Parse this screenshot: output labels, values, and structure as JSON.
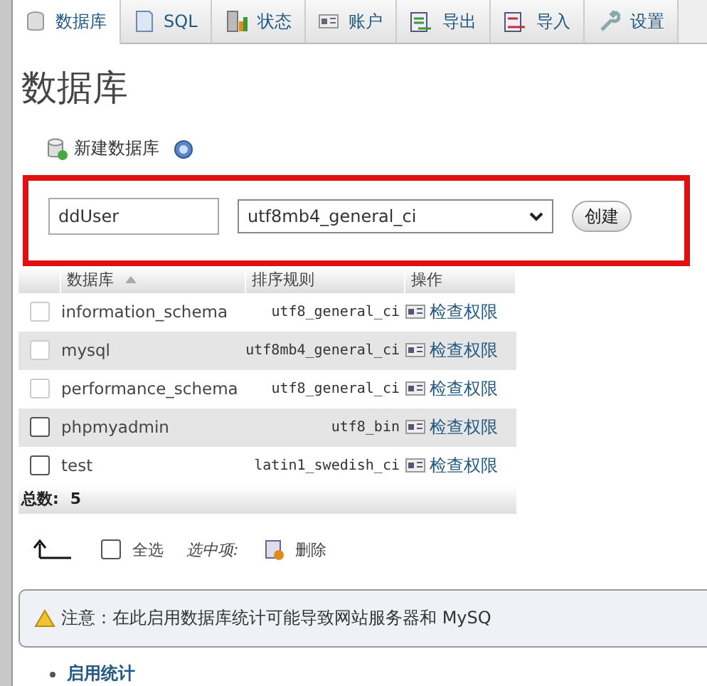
{
  "tabs": [
    {
      "label": "数据库",
      "selected": true
    },
    {
      "label": "SQL",
      "selected": false
    },
    {
      "label": "状态",
      "selected": false
    },
    {
      "label": "账户",
      "selected": false
    },
    {
      "label": "导出",
      "selected": false
    },
    {
      "label": "导入",
      "selected": false
    },
    {
      "label": "设置",
      "selected": false
    }
  ],
  "page_title": "数据库",
  "create_db": {
    "heading": "新建数据库",
    "name_value": "ddUser",
    "collation_value": "utf8mb4_general_ci",
    "button": "创建"
  },
  "table": {
    "columns": [
      "数据库",
      "排序规则",
      "操作"
    ],
    "rows": [
      {
        "name": "information_schema",
        "collation": "utf8_general_ci",
        "action": "检查权限",
        "disabled": true
      },
      {
        "name": "mysql",
        "collation": "utf8mb4_general_ci",
        "action": "检查权限",
        "disabled": true
      },
      {
        "name": "performance_schema",
        "collation": "utf8_general_ci",
        "action": "检查权限",
        "disabled": true
      },
      {
        "name": "phpmyadmin",
        "collation": "utf8_bin",
        "action": "检查权限",
        "disabled": false
      },
      {
        "name": "test",
        "collation": "latin1_swedish_ci",
        "action": "检查权限",
        "disabled": false
      }
    ],
    "total_label": "总数:",
    "total_value": "5"
  },
  "bulk": {
    "select_all": "全选",
    "select_all_checked": false,
    "with_selected": "选中项:",
    "delete": "删除"
  },
  "notice": "注意：在此启用数据库统计可能导致网站服务器和 MySQ",
  "enable_stats": "启用统计"
}
